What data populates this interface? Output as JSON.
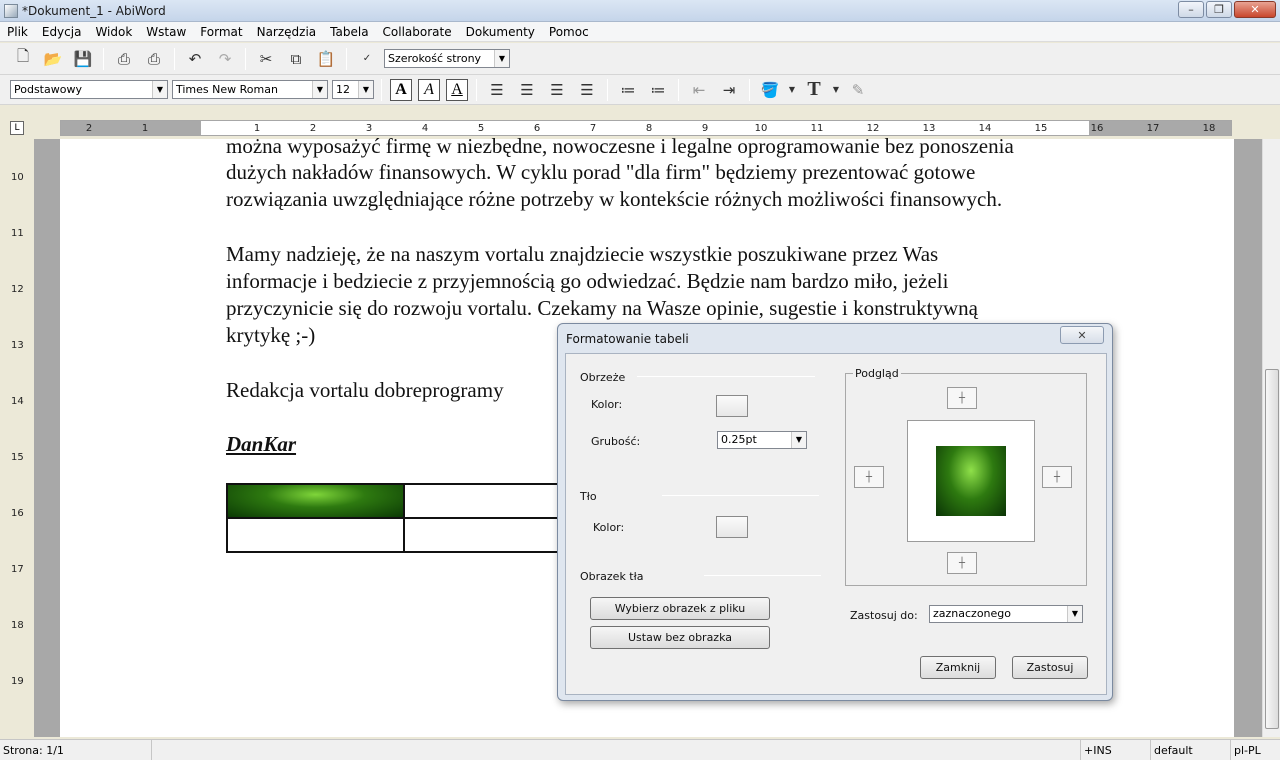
{
  "window": {
    "title": "*Dokument_1 - AbiWord"
  },
  "menu": [
    "Plik",
    "Edycja",
    "Widok",
    "Wstaw",
    "Format",
    "Narzędzia",
    "Tabela",
    "Collaborate",
    "Dokumenty",
    "Pomoc"
  ],
  "toolbar1": {
    "zoom_value": "Szerokość strony"
  },
  "toolbar2": {
    "style_value": "Podstawowy",
    "font_value": "Times New Roman",
    "size_value": "12",
    "bold": "A",
    "italic": "A",
    "underline": "A"
  },
  "ruler": {
    "ticks": [
      "2",
      "1",
      "1",
      "2",
      "3",
      "4",
      "5",
      "6",
      "7",
      "8",
      "9",
      "10",
      "11",
      "12",
      "13",
      "14",
      "15",
      "16",
      "17",
      "18"
    ],
    "corner": "L"
  },
  "vruler": {
    "ticks": [
      "10",
      "11",
      "12",
      "13",
      "14",
      "15",
      "16",
      "17",
      "18",
      "19"
    ]
  },
  "document": {
    "lines": [
      "można wyposażyć firmę w niezbędne, nowoczesne i legalne oprogramowanie bez ponoszenia",
      "dużych nakładów finansowych. W cyklu porad \"dla firm\" będziemy prezentować gotowe",
      "rozwiązania uwzględniające różne potrzeby w kontekście różnych możliwości finansowych.",
      "Mamy nadzieję, że na naszym vortalu znajdziecie wszystkie poszukiwane przez Was",
      "informacje i bedziecie z przyjemnością go odwiedzać. Będzie nam bardzo miło, jeżeli",
      "przyczynicie się do rozwoju vortalu. Czekamy na Wasze opinie, sugestie i konstruktywną",
      "krytykę ;-)",
      "Redakcja vortalu dobreprogramy"
    ],
    "signature": "DanKar"
  },
  "dialog": {
    "title": "Formatowanie tabeli",
    "close": "✕",
    "border_group": "Obrzeże",
    "border_color_label": "Kolor:",
    "thickness_label": "Grubość:",
    "thickness_value": "0.25pt",
    "bg_group": "Tło",
    "bg_color_label": "Kolor:",
    "image_group": "Obrazek tła",
    "choose_image": "Wybierz obrazek z pliku",
    "no_image": "Ustaw bez obrazka",
    "preview_group": "Podgląd",
    "apply_to_label": "Zastosuj do:",
    "apply_to_value": "zaznaczonego",
    "close_btn": "Zamknij",
    "apply_btn": "Zastosuj"
  },
  "status": {
    "page": "Strona: 1/1",
    "ins": "+INS",
    "mode": "default",
    "lang": "pl-PL"
  }
}
